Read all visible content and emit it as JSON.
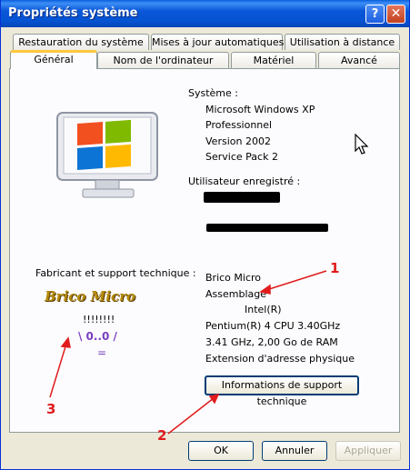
{
  "window": {
    "title": "Propriétés système",
    "help_glyph": "?",
    "close_glyph": "✕"
  },
  "tabs_row1": [
    "Restauration du système",
    "Mises à jour automatiques",
    "Utilisation à distance"
  ],
  "tabs_row2": [
    "Général",
    "Nom de l'ordinateur",
    "Matériel",
    "Avancé"
  ],
  "system": {
    "heading": "Système :",
    "os": "Microsoft Windows XP",
    "edition": "Professionnel",
    "version": "Version 2002",
    "service_pack": "Service Pack 2"
  },
  "registered": {
    "heading": "Utilisateur enregistré :"
  },
  "manufacturer": {
    "heading": "Fabricant et support technique :",
    "logo_text": "Brico Micro",
    "art_line1": "!!!!!!!!",
    "art_line2": "\\ 0..0 /",
    "art_line3": "=",
    "name": "Brico Micro",
    "model": "Assemblage",
    "cpu_vendor": "Intel(R)",
    "cpu": "Pentium(R) 4 CPU 3.40GHz",
    "speed_ram": "3.41 GHz, 2,00 Go de RAM",
    "pae": "Extension d'adresse physique",
    "support_button": "Informations de support technique"
  },
  "buttons": {
    "ok": "OK",
    "cancel": "Annuler",
    "apply": "Appliquer"
  },
  "annotations": {
    "n1": "1",
    "n2": "2",
    "n3": "3"
  },
  "colors": {
    "annotation": "#e01c1c",
    "active_tab_accent": "#ffc83c",
    "titlebar": "#0a56d8"
  },
  "icons": [
    "help-icon",
    "close-icon",
    "windows-monitor-icon",
    "mouse-cursor-icon"
  ]
}
